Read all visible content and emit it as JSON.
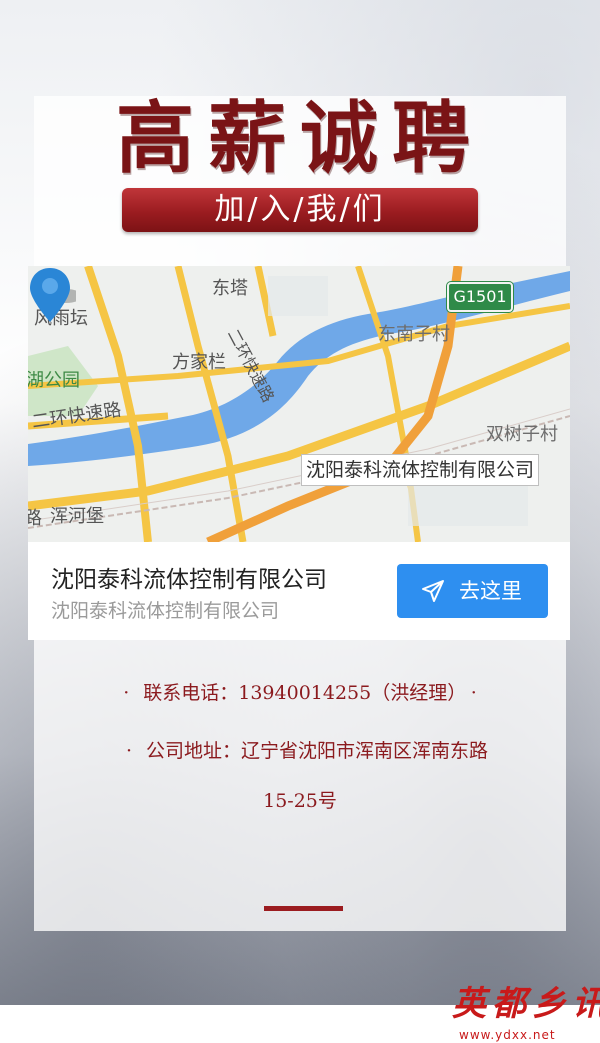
{
  "header": {
    "headline": "高薪诚聘",
    "join_banner": "加/入/我/们"
  },
  "map": {
    "labels": {
      "dongta": "东塔",
      "fengyutan": "风雨坛",
      "fangjialan": "方家栏",
      "hugongyuan": "湖公园",
      "erhuan_kuaisulu_left": "二环快速路",
      "erhuan_kuaisulu_vertical": "二环快速路",
      "dongnanzicun": "东南子村",
      "shuangshuzicun": "双树子村",
      "hunhebao": "浑河堡",
      "lu": "路"
    },
    "road_badge": "G1501",
    "marker_label": "沈阳泰科流体控制有限公司",
    "colors": {
      "water": "#6fa8e8",
      "road": "#f5c544",
      "expressway": "#f0a03a",
      "base": "#eef0ee"
    }
  },
  "card": {
    "title": "沈阳泰科流体控制有限公司",
    "subtitle": "沈阳泰科流体控制有限公司",
    "go_button": "去这里",
    "accent_color": "#2e8ff0"
  },
  "contact": {
    "bullet": "·",
    "phone_line": "联系电话：13940014255（洪经理）",
    "address_line1": "公司地址：辽宁省沈阳市浑南区浑南东路",
    "address_line2": "15-25号",
    "color": "#8b1a1e"
  },
  "footer": {
    "logo_text": "英都乡讯",
    "logo_url": "www.ydxx.net"
  }
}
